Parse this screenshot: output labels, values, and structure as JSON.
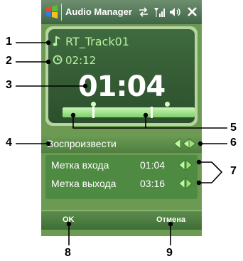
{
  "window": {
    "title": "Audio Manager"
  },
  "display": {
    "track_name": "RT_Track01",
    "duration": "02:12",
    "current_time": "01:04"
  },
  "playback": {
    "play_label": "Воспроизвести"
  },
  "marks": {
    "in_label": "Метка входа",
    "in_time": "01:04",
    "out_label": "Метка выхода",
    "out_time": "03:16"
  },
  "softkeys": {
    "left": "OK",
    "right": "Отмена"
  },
  "callouts": [
    "1",
    "2",
    "3",
    "4",
    "5",
    "6",
    "7",
    "8",
    "9"
  ],
  "colors": {
    "screen_bg": "#6d9a52",
    "display_bg": "#2c4f2d",
    "display_text": "#b6f0a2",
    "trim_bar": "#7fd06a"
  },
  "icons": [
    "windows-start-icon",
    "connectivity-icon",
    "signal-icon",
    "volume-icon",
    "close-icon",
    "music-note-icon",
    "clock-icon",
    "arrow-pair-icon"
  ]
}
